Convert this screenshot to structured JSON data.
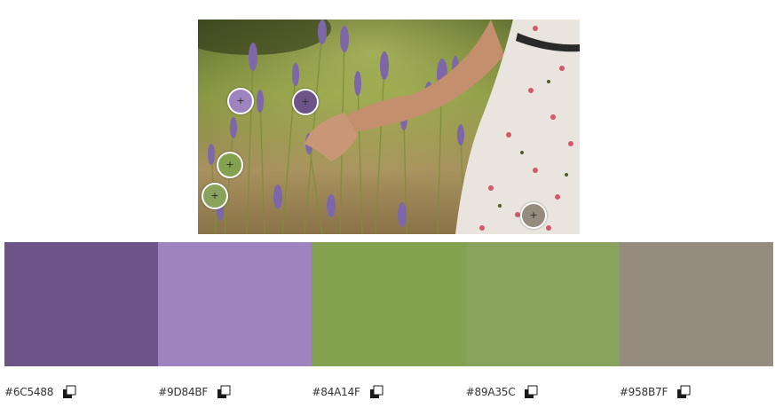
{
  "photo": {
    "description_icon": "lavender-field-photo"
  },
  "pickers": [
    {
      "color": "#9D84BF",
      "glyph": "+"
    },
    {
      "color": "#6C5488",
      "glyph": "+"
    },
    {
      "color": "#84A14F",
      "glyph": "+"
    },
    {
      "color": "#89A35C",
      "glyph": "+"
    },
    {
      "color": "#958B7F",
      "glyph": "+"
    }
  ],
  "palette": [
    {
      "hex": "#6C5488",
      "color": "#6C5488"
    },
    {
      "hex": "#9D84BF",
      "color": "#9D84BF"
    },
    {
      "hex": "#84A14F",
      "color": "#84A14F"
    },
    {
      "hex": "#89A35C",
      "color": "#89A35C"
    },
    {
      "hex": "#958B7F",
      "color": "#958B7F"
    }
  ],
  "icons": {
    "copy": "copy-icon"
  }
}
